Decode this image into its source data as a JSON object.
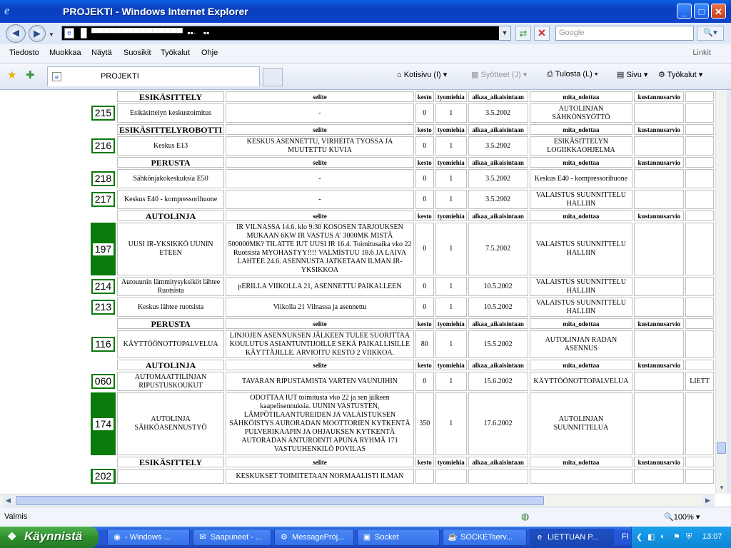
{
  "window": {
    "title": "PROJEKTI - Windows Internet Explorer",
    "min": "_",
    "max": "□",
    "close": "✕"
  },
  "nav": {
    "back": "◀",
    "forward": "▶",
    "url": "█  ▀▀▀▀▀▀▀▀▀▀▀▀▀▀▀  ▪▪·   ▪▪",
    "search_placeholder": "Google",
    "search_btn": "🔍▾"
  },
  "menu": [
    "Tiedosto",
    "Muokkaa",
    "Näytä",
    "Suosikit",
    "Työkalut",
    "Ohje"
  ],
  "menu_links": "Linkit",
  "tab": {
    "label": "PROJEKTI"
  },
  "commandbar": {
    "home": "Kotisivu (I)",
    "feeds": "Syötteet (J)",
    "print": "Tulosta (L)",
    "page": "Sivu",
    "tools": "Työkalut"
  },
  "headers": {
    "selite": "selite",
    "kesto": "kesto",
    "tyomiehia": "tyomiehia",
    "alkaa": "alkaa_aikaisintaan",
    "mita": "mita_odottaa",
    "kust": "kustannusarvio"
  },
  "rows": [
    {
      "t": "h",
      "section": "ESIKÄSITTELY"
    },
    {
      "t": "d",
      "id": "215",
      "name": "Esikäsittelyn keskustoimitus",
      "selite": "-",
      "kesto": "0",
      "tyo": "1",
      "alkaa": "3.5.2002",
      "mita": "AUTOLINJAN SÄHKÖNSYÖTTÖ",
      "kust": "",
      "extra": ""
    },
    {
      "t": "h",
      "section": "ESIKÄSITTELYROBOTTI"
    },
    {
      "t": "d",
      "id": "216",
      "name": "Keskus E13",
      "selite": "KESKUS ASENNETTU, VIRHEITA TYOSSA JA MUUTETTU KUVIA",
      "kesto": "0",
      "tyo": "1",
      "alkaa": "3.5.2002",
      "mita": "ESIKÄSITTELYN LOGIIKKAOHJELMA",
      "kust": "",
      "extra": ""
    },
    {
      "t": "h",
      "section": "PERUSTA"
    },
    {
      "t": "d",
      "id": "218",
      "name": "Sähkönjakokeskuksia E50",
      "selite": "-",
      "kesto": "0",
      "tyo": "1",
      "alkaa": "3.5.2002",
      "mita": "Keskus E40 - kompressorihuone",
      "kust": "",
      "extra": ""
    },
    {
      "t": "d",
      "id": "217",
      "name": "Keskus E40 - kompressorihuone",
      "selite": "-",
      "kesto": "0",
      "tyo": "1",
      "alkaa": "3.5.2002",
      "mita": "VALAISTUS SUUNNITTELU HALLIIN",
      "kust": "",
      "extra": ""
    },
    {
      "t": "h",
      "section": "AUTOLINJA"
    },
    {
      "t": "d",
      "id": "197",
      "green": true,
      "name": "UUSI IR-YKSIKKÖ UUNIN ETEEN",
      "selite": "IR VILNASSA 14.6. klo 9:30 KOSOSEN TARJOUKSEN MUKAAN 6KW IR VASTUS A' 3000MK MISTÄ 500000MK? TILATTE IUT UUSI IR 16.4. Toimitusaika vko 22 Ruotsista MYOHASTYY!!!! VALMISTUU 18.6 JA LAIVA LAHTEE 24.6. ASENNUSTA JATKETAAN ILMAN IR-YKSIKKOA",
      "kesto": "0",
      "tyo": "1",
      "alkaa": "7.5.2002",
      "mita": "VALAISTUS SUUNNITTELU HALLIIN",
      "kust": "",
      "extra": ""
    },
    {
      "t": "d",
      "id": "214",
      "name": "Autouunin lämmitysyksiköt lähtee Ruotsista",
      "selite": "pERILLA VIIKOLLA 21, ASENNETTU PAIKALLEEN",
      "kesto": "0",
      "tyo": "1",
      "alkaa": "10.5.2002",
      "mita": "VALAISTUS SUUNNITTELU HALLIIN",
      "kust": "",
      "extra": ""
    },
    {
      "t": "d",
      "id": "213",
      "name": "Keskus lähtee ruotsista",
      "selite": "Viikolla 21 Vilnassa ja asennettu",
      "kesto": "0",
      "tyo": "1",
      "alkaa": "10.5.2002",
      "mita": "VALAISTUS SUUNNITTELU HALLIIN",
      "kust": "",
      "extra": ""
    },
    {
      "t": "h",
      "section": "PERUSTA"
    },
    {
      "t": "d",
      "id": "116",
      "name": "KÄYTTÖÖNOTTOPALVELUA",
      "selite": "LINJOJEN ASENNUKSEN JÄLKEEN TULEE SUORITTAA KOULUTUS ASIANTUNTIJOILLE SEKÄ PAIKALLISILLE KÄYTTÄJILLE. ARVIOITU KESTO 2 VIIKKOA.",
      "kesto": "80",
      "tyo": "1",
      "alkaa": "15.5.2002",
      "mita": "AUTOLINJAN RADAN ASENNUS",
      "kust": "",
      "extra": ""
    },
    {
      "t": "h",
      "section": "AUTOLINJA"
    },
    {
      "t": "d",
      "id": "060",
      "name": "AUTOMAATTILINJAN RIPUSTUSKOUKUT",
      "selite": "TAVARAN RIPUSTAMISTA VARTEN VAUNUIHIN",
      "kesto": "0",
      "tyo": "1",
      "alkaa": "15.6.2002",
      "mita": "KÄYTTÖÖNOTTOPALVELUA",
      "kust": "",
      "extra": "LIETT"
    },
    {
      "t": "d",
      "id": "174",
      "green": true,
      "name": "AUTOLINJA SÄHKÖASENNUSTYÖ",
      "selite": "ODOTTAA IUT toimitusta vko 22 ja sen jälkeen kaapelisennuksia. UUNIN VASTUSTEN, LÄMPÖTILAANTUREIDEN JA VALAISTUKSEN SÄHKÖISTYS AURORADAN MOOTTORIEN KYTKENTÄ PULVERIKAAPIN JA OHJAUKSEN KYTKENTÄ AUTORADAN ANTUROINTI APUNA RYHMÄ 171 VASTUUHENKILÖ POVILAS",
      "kesto": "350",
      "tyo": "1",
      "alkaa": "17.6.2002",
      "mita": "AUTOLINJAN SUUNNITTELUA",
      "kust": "",
      "extra": ""
    },
    {
      "t": "h",
      "section": "ESIKÄSITTELY"
    },
    {
      "t": "d",
      "id": "202",
      "green": true,
      "name": "",
      "selite": "KESKUKSET TOIMITETAAN NORMAALISTI ILMAN",
      "kesto": "",
      "tyo": "",
      "alkaa": "",
      "mita": "",
      "kust": "",
      "extra": ""
    }
  ],
  "status": {
    "text": "Valmis",
    "zoom": "🔍100%  ▾"
  },
  "taskbar": {
    "start": "Käynnistä",
    "items": [
      {
        "icon": "◉",
        "label": "- Windows ..."
      },
      {
        "icon": "✉",
        "label": "Saapuneet - ..."
      },
      {
        "icon": "⚙",
        "label": "MessageProj..."
      },
      {
        "icon": "▣",
        "label": "Socket"
      },
      {
        "icon": "☕",
        "label": "SOCKETserv..."
      },
      {
        "icon": "e",
        "label": "LIETTUAN P..."
      }
    ],
    "lang": "FI",
    "clock": "13:07"
  }
}
